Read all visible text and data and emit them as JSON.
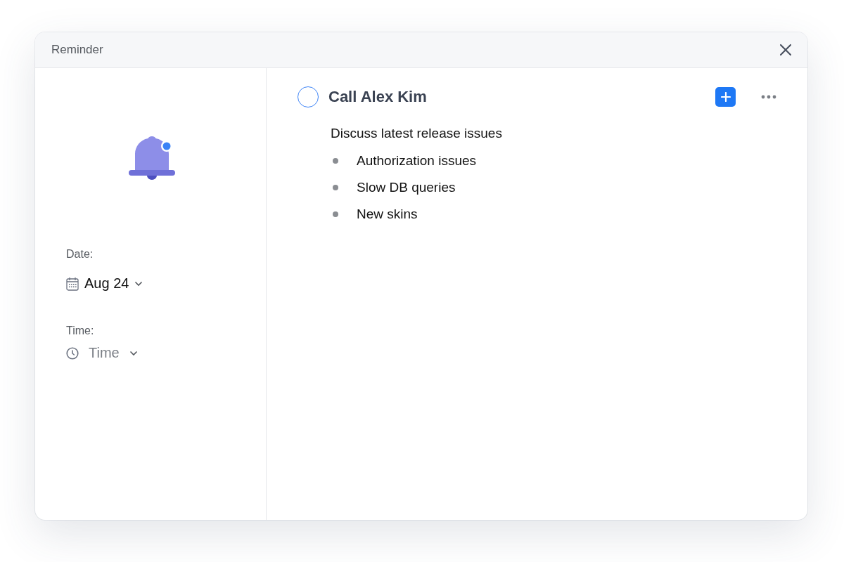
{
  "window": {
    "title": "Reminder"
  },
  "date": {
    "label": "Date:",
    "value": "Aug 24"
  },
  "time": {
    "label": "Time:",
    "placeholder": "Time"
  },
  "task": {
    "title": "Call Alex Kim",
    "completed": false,
    "description": "Discuss latest release issues",
    "items": [
      "Authorization issues",
      "Slow DB queries",
      "New skins"
    ]
  }
}
